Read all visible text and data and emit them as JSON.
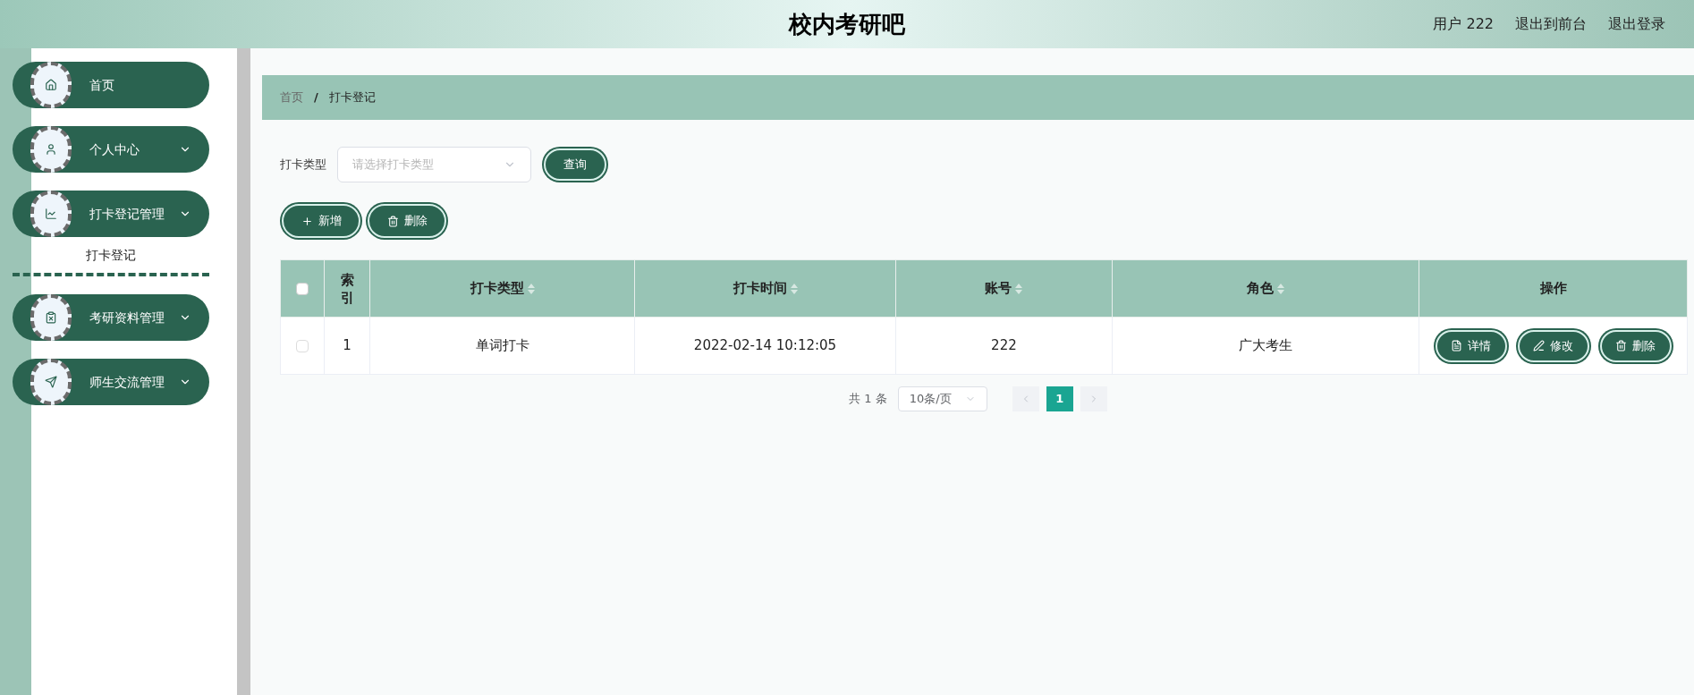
{
  "header": {
    "title": "校内考研吧",
    "links": [
      "用户 222",
      "退出到前台",
      "退出登录"
    ]
  },
  "sidebar": {
    "items": [
      {
        "label": "首页",
        "kind": "home",
        "has_arrow": false
      },
      {
        "label": "个人中心",
        "kind": "user",
        "has_arrow": true
      },
      {
        "label": "打卡登记管理",
        "kind": "chart",
        "has_arrow": true,
        "children": [
          {
            "label": "打卡登记"
          }
        ]
      },
      {
        "label": "考研资料管理",
        "kind": "clipboard",
        "has_arrow": true
      },
      {
        "label": "师生交流管理",
        "kind": "send",
        "has_arrow": true
      }
    ]
  },
  "breadcrumb": {
    "separator": "/",
    "items": [
      "首页",
      "打卡登记"
    ]
  },
  "filter": {
    "label": "打卡类型",
    "placeholder": "请选择打卡类型",
    "button": "查询"
  },
  "actions": [
    {
      "label": "新增",
      "kind": "plus"
    },
    {
      "label": "删除",
      "kind": "trash"
    }
  ],
  "table": {
    "all_checked": false,
    "columns": [
      {
        "label": "索引",
        "sortable": false
      },
      {
        "label": "打卡类型",
        "sortable": true
      },
      {
        "label": "打卡时间",
        "sortable": true
      },
      {
        "label": "账号",
        "sortable": true
      },
      {
        "label": "角色",
        "sortable": true
      },
      {
        "label": "操作",
        "sortable": false
      }
    ],
    "rows": [
      {
        "checked": false,
        "cells": [
          "1",
          "单词打卡",
          "2022-02-14 10:12:05",
          "222",
          "广大考生"
        ],
        "buttons": [
          {
            "label": "详情",
            "kind": "doc"
          },
          {
            "label": "修改",
            "kind": "pen"
          },
          {
            "label": "删除",
            "kind": "trash"
          }
        ]
      }
    ]
  },
  "pagination": {
    "total": "共 1 条",
    "page_size": "10条/页",
    "pages": [
      {
        "label": "1",
        "selected": true
      }
    ]
  }
}
